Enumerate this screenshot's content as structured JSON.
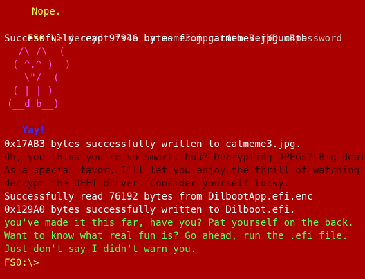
{
  "colors": {
    "background": "#ab0000",
    "prompt": "#ffff55",
    "output": "#ffffff",
    "typed_command": "#c8c8c8",
    "ascii_art": "#ff55ff",
    "yay": "#3333ff",
    "taunt_red": "#2a0000",
    "taunt_green": "#55ff55"
  },
  "terminal": {
    "nope": "Nope.",
    "prompt": "FS0:\\>",
    "command": " decrypt_file catmeme3.jpg.c4tb VerYDumBpassword",
    "read_msg": "Successfully read 97946 bytes from catmeme3.jpg.c4tb",
    "cat_art": [
      " /\\_/\\  (",
      "( ^.^ ) _)",
      "  \\\"/  (",
      "( | | )",
      "(__d b__)"
    ],
    "yay": "Yay!",
    "written_msg": "0x17AB3 bytes successfully written to catmeme3.jpg.",
    "taunt_red": [
      "Oh, you think you're so smart, huh? Decrypting JPEGs? Big deal.",
      "As a special favor, I'll let you enjoy the thrill of watching me",
      "decrypt the UEFI driver. Consider yourself lucky."
    ],
    "read_msg2": "Successfully read 76192 bytes from DilbootApp.efi.enc",
    "written_msg2": "0x129A0 bytes successfully written to Dilboot.efi.",
    "taunt_green": [
      "you've made it this far, have you? Pat yourself on the back.",
      "Want to know what real fun is? Go ahead, run the .efi file.",
      "Just don't say I didn't warn you."
    ],
    "final_prompt": "FS0:\\>"
  }
}
